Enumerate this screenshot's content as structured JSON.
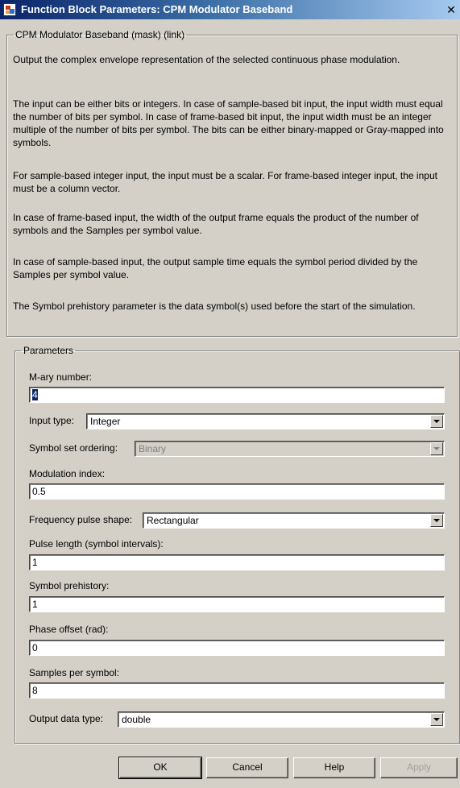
{
  "window": {
    "title": "Function Block Parameters: CPM Modulator Baseband",
    "close_glyph": "✕"
  },
  "description_group": {
    "legend": "CPM Modulator Baseband (mask) (link)",
    "paragraphs": [
      "Output the complex envelope representation of the selected continuous phase modulation.",
      "The input can be either bits or integers. In case of sample-based bit input, the input width must equal the number of bits per symbol. In case of frame-based bit input, the input width must be an integer multiple of the number of bits per symbol. The bits can be either binary-mapped or Gray-mapped into symbols.",
      "For sample-based integer input, the input must be a scalar. For frame-based integer input, the input must be a column vector.",
      "In case of frame-based input, the width of the output frame equals the product of the number of symbols and the Samples per symbol value.",
      "In case of sample-based input, the output sample time equals the symbol period divided by the Samples per symbol value.",
      "The Symbol prehistory parameter is the data symbol(s) used before the start of the simulation."
    ]
  },
  "parameters": {
    "legend": "Parameters",
    "mary_label": "M-ary number:",
    "mary_value": "4",
    "input_type_label": "Input type:",
    "input_type_value": "Integer",
    "symbol_set_label": "Symbol set ordering:",
    "symbol_set_value": "Binary",
    "mod_index_label": "Modulation index:",
    "mod_index_value": "0.5",
    "freq_pulse_label": "Frequency pulse shape:",
    "freq_pulse_value": "Rectangular",
    "pulse_length_label": "Pulse length (symbol intervals):",
    "pulse_length_value": "1",
    "prehistory_label": "Symbol prehistory:",
    "prehistory_value": "1",
    "phase_offset_label": "Phase offset (rad):",
    "phase_offset_value": "0",
    "samples_label": "Samples per symbol:",
    "samples_value": "8",
    "output_type_label": "Output data type:",
    "output_type_value": "double"
  },
  "buttons": {
    "ok": "OK",
    "cancel": "Cancel",
    "help": "Help",
    "apply": "Apply"
  }
}
